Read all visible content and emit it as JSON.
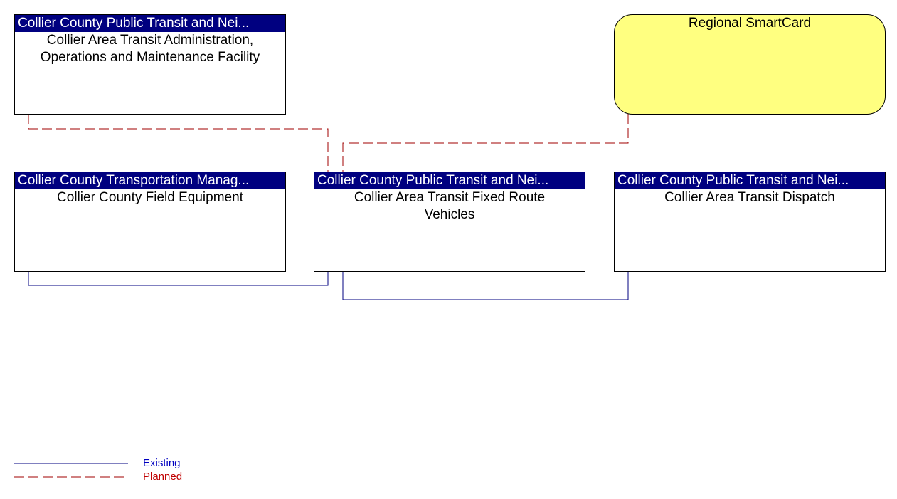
{
  "nodes": [
    {
      "id": "admin",
      "header": "Collier County Public Transit and Nei...",
      "label": "Collier Area Transit Administration, Operations and Maintenance Facility"
    },
    {
      "id": "smartcard",
      "header": "",
      "label": "Regional SmartCard"
    },
    {
      "id": "field",
      "header": "Collier County Transportation Manag...",
      "label": "Collier County Field Equipment"
    },
    {
      "id": "vehicles",
      "header": "Collier County Public Transit and Nei...",
      "label": "Collier Area Transit Fixed Route Vehicles"
    },
    {
      "id": "dispatch",
      "header": "Collier County Public Transit and Nei...",
      "label": "Collier Area Transit Dispatch"
    }
  ],
  "connections": [
    {
      "from": "admin",
      "to": "vehicles",
      "status": "Planned"
    },
    {
      "from": "smartcard",
      "to": "vehicles",
      "status": "Planned"
    },
    {
      "from": "field",
      "to": "vehicles",
      "status": "Existing"
    },
    {
      "from": "vehicles",
      "to": "dispatch",
      "status": "Existing"
    }
  ],
  "legend": {
    "existing": {
      "label": "Existing",
      "color": "#0000c0"
    },
    "planned": {
      "label": "Planned",
      "color": "#c00000"
    }
  },
  "colors": {
    "header_bg": "#000080",
    "external_bg": "#ffff80",
    "existing_line": "#000080",
    "planned_line": "#a00000"
  }
}
